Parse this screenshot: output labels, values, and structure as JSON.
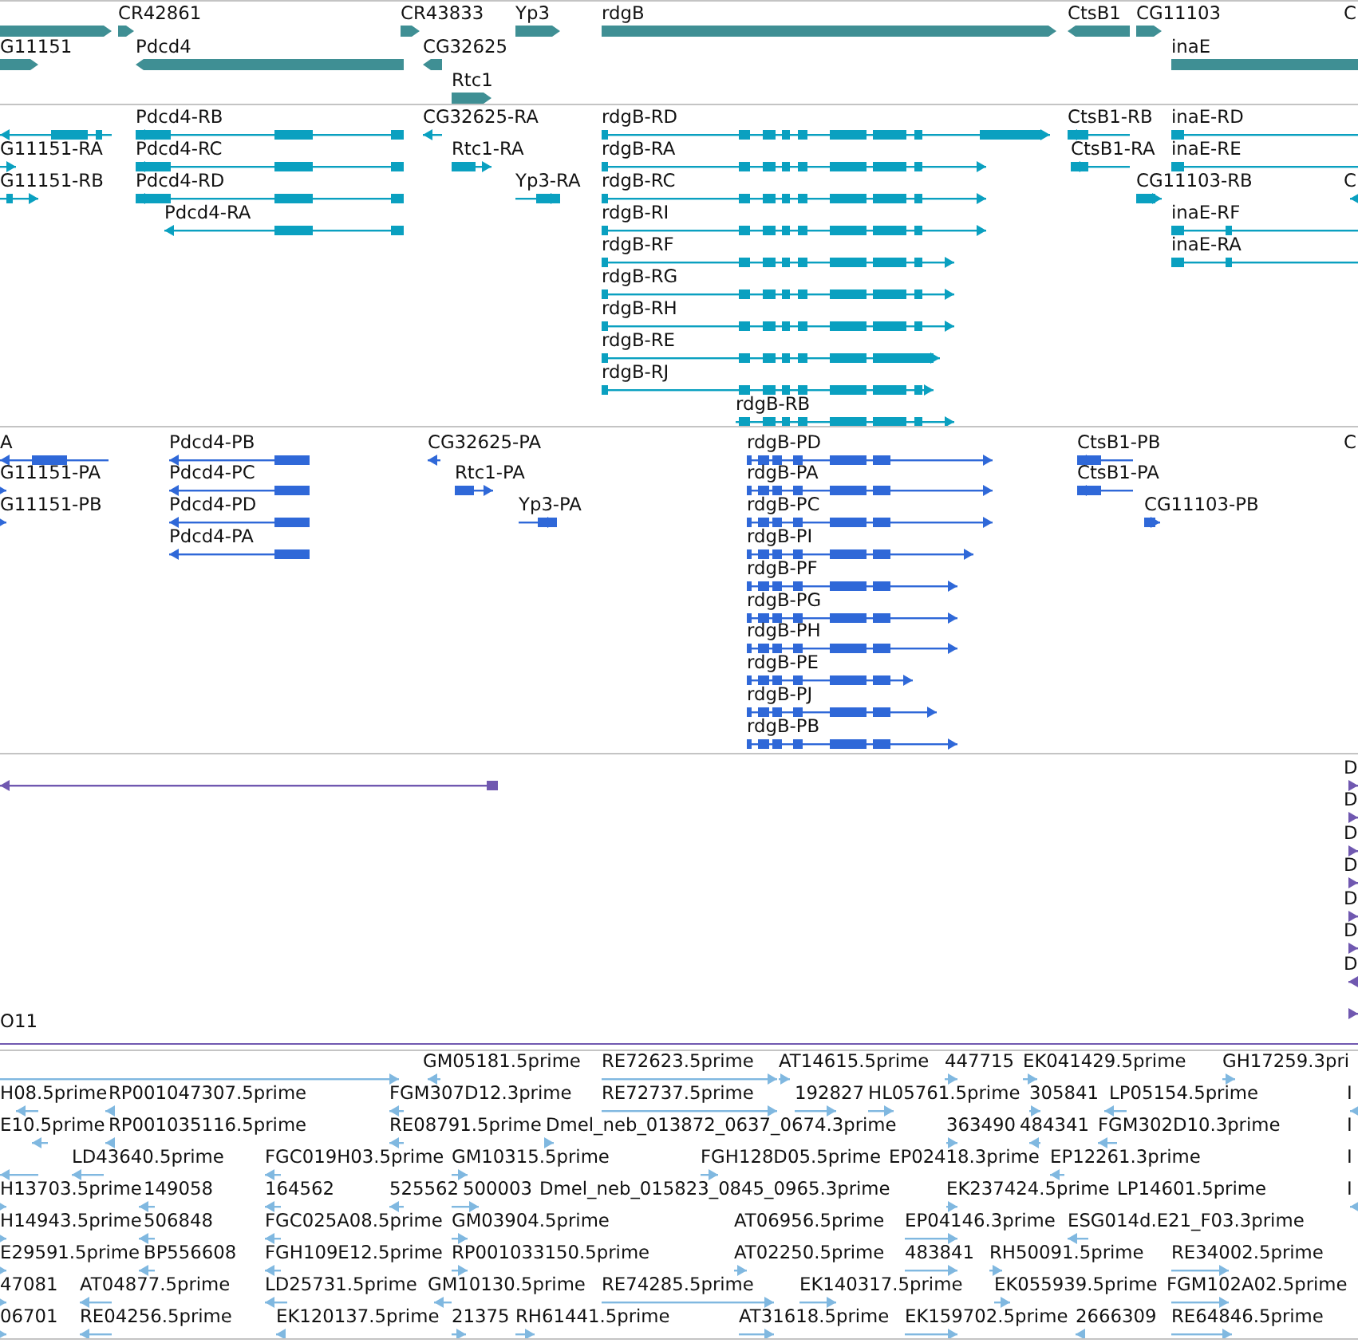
{
  "tracks": [
    {
      "kind": "gene",
      "features": [
        {
          "reverse": false
        },
        {
          "label": "G11151",
          "reverse": false
        },
        {
          "label": "CR42861",
          "reverse": false
        },
        {
          "label": "Pdcd4",
          "reverse": true
        },
        {
          "label": "CR43833",
          "reverse": false
        },
        {
          "label": "CG32625",
          "reverse": true
        },
        {
          "label": "Rtc1",
          "reverse": false
        },
        {
          "label": "Yp3",
          "reverse": false
        },
        {
          "label": "rdgB",
          "reverse": false
        },
        {
          "label": "CtsB1",
          "reverse": true
        },
        {
          "label": "CG11103",
          "reverse": false
        },
        {
          "label": "inaE",
          "reverse": false
        },
        {
          "label": "C"
        }
      ]
    },
    {
      "kind": "transcript",
      "features": [
        {
          "reverse": true
        },
        {
          "label": "G11151-RA",
          "reverse": false
        },
        {
          "label": "G11151-RB",
          "reverse": false
        },
        {
          "label": "Pdcd4-RB",
          "reverse": true
        },
        {
          "label": "Pdcd4-RC",
          "reverse": true
        },
        {
          "label": "Pdcd4-RD",
          "reverse": true
        },
        {
          "label": "Pdcd4-RA",
          "reverse": true
        },
        {
          "label": "CG32625-RA",
          "reverse": true
        },
        {
          "label": "Rtc1-RA",
          "reverse": false
        },
        {
          "label": "Yp3-RA",
          "reverse": false
        },
        {
          "label": "rdgB-RD",
          "reverse": false
        },
        {
          "label": "rdgB-RA",
          "reverse": false
        },
        {
          "label": "rdgB-RC",
          "reverse": false
        },
        {
          "label": "rdgB-RI",
          "reverse": false
        },
        {
          "label": "rdgB-RF",
          "reverse": false
        },
        {
          "label": "rdgB-RG",
          "reverse": false
        },
        {
          "label": "rdgB-RH",
          "reverse": false
        },
        {
          "label": "rdgB-RE",
          "reverse": false
        },
        {
          "label": "rdgB-RJ",
          "reverse": false
        },
        {
          "label": "rdgB-RB",
          "reverse": false
        },
        {
          "label": "CtsB1-RB",
          "reverse": true
        },
        {
          "label": "CtsB1-RA",
          "reverse": true
        },
        {
          "label": "inaE-RD",
          "reverse": false
        },
        {
          "label": "inaE-RE",
          "reverse": false
        },
        {
          "label": "CG11103-RB",
          "reverse": false
        },
        {
          "label": "inaE-RF",
          "reverse": false
        },
        {
          "label": "inaE-RA",
          "reverse": false
        },
        {
          "label": "C",
          "reverse": true
        }
      ]
    },
    {
      "kind": "protein",
      "features": [
        {
          "label": "A",
          "reverse": true
        },
        {
          "label": "G11151-PA",
          "reverse": false
        },
        {
          "label": "G11151-PB",
          "reverse": false
        },
        {
          "label": "Pdcd4-PB",
          "reverse": true
        },
        {
          "label": "Pdcd4-PC",
          "reverse": true
        },
        {
          "label": "Pdcd4-PD",
          "reverse": true
        },
        {
          "label": "Pdcd4-PA",
          "reverse": true
        },
        {
          "label": "CG32625-PA",
          "reverse": true
        },
        {
          "label": "Rtc1-PA",
          "reverse": false
        },
        {
          "label": "Yp3-PA",
          "reverse": false
        },
        {
          "label": "rdgB-PD",
          "reverse": false
        },
        {
          "label": "rdgB-PA",
          "reverse": false
        },
        {
          "label": "rdgB-PC",
          "reverse": false
        },
        {
          "label": "rdgB-PI",
          "reverse": false
        },
        {
          "label": "rdgB-PF",
          "reverse": false
        },
        {
          "label": "rdgB-PG",
          "reverse": false
        },
        {
          "label": "rdgB-PH",
          "reverse": false
        },
        {
          "label": "rdgB-PE",
          "reverse": false
        },
        {
          "label": "rdgB-PJ",
          "reverse": false
        },
        {
          "label": "rdgB-PB",
          "reverse": false
        },
        {
          "label": "CtsB1-PB",
          "reverse": true
        },
        {
          "label": "CtsB1-PA",
          "reverse": true
        },
        {
          "label": "CG11103-PB",
          "reverse": false
        },
        {
          "label": "C"
        }
      ]
    },
    {
      "kind": "alignment",
      "features": [
        {
          "reverse": true
        },
        {
          "label": "D",
          "reverse": false
        },
        {
          "label": "D",
          "reverse": false
        },
        {
          "label": "D",
          "reverse": false
        },
        {
          "label": "D",
          "reverse": false
        },
        {
          "label": "D",
          "reverse": false
        },
        {
          "label": "D",
          "reverse": false
        },
        {
          "label": "D",
          "reverse": true
        },
        {
          "reverse": false
        },
        {
          "label": "O11"
        }
      ]
    },
    {
      "kind": "est",
      "features": [
        {
          "reverse": false
        },
        {
          "label": "GM05181.5prime",
          "reverse": true
        },
        {
          "label": "RE72623.5prime",
          "reverse": false
        },
        {
          "label": "AT14615.5prime",
          "reverse": false
        },
        {
          "label": "447715",
          "reverse": false
        },
        {
          "label": "EK041429.5prime",
          "reverse": false
        },
        {
          "label": "GH17259.3pri",
          "reverse": false
        },
        {
          "label": "H08.5prime",
          "reverse": true
        },
        {
          "label": "RP001047307.5prime",
          "reverse": true
        },
        {
          "label": "FGM307D12.3prime",
          "reverse": true
        },
        {
          "label": "RE72737.5prime",
          "reverse": false
        },
        {
          "label": "192827",
          "reverse": false
        },
        {
          "label": "HL05761.5prime",
          "reverse": false
        },
        {
          "label": "305841",
          "reverse": false
        },
        {
          "label": "LP05154.5prime",
          "reverse": true
        },
        {
          "label": "I",
          "reverse": true
        },
        {
          "label": "E10.5prime",
          "reverse": true
        },
        {
          "label": "RP001035116.5prime",
          "reverse": true
        },
        {
          "label": "RE08791.5prime",
          "reverse": true
        },
        {
          "label": "Dmel_neb_013872_0637_0674.3prime",
          "reverse": false
        },
        {
          "label": "363490",
          "reverse": false
        },
        {
          "label": "484341",
          "reverse": true
        },
        {
          "label": "FGM302D10.3prime",
          "reverse": true
        },
        {
          "label": "I"
        },
        {
          "reverse": true
        },
        {
          "label": "LD43640.5prime",
          "reverse": true
        },
        {
          "label": "FGC019H03.5prime",
          "reverse": true
        },
        {
          "label": "GM10315.5prime",
          "reverse": false
        },
        {
          "label": "FGH128D05.5prime",
          "reverse": false
        },
        {
          "label": "EP02418.3prime"
        },
        {
          "label": "EP12261.3prime",
          "reverse": true
        },
        {
          "label": "I"
        },
        {
          "label": "H13703.5prime",
          "reverse": false
        },
        {
          "label": "149058",
          "reverse": true
        },
        {
          "label": "164562",
          "reverse": true
        },
        {
          "label": "525562",
          "reverse": true
        },
        {
          "label": "500003",
          "reverse": false
        },
        {
          "label": "Dmel_neb_015823_0845_0965.3prime"
        },
        {
          "label": "EK237424.5prime",
          "reverse": false
        },
        {
          "label": "LP14601.5prime"
        },
        {
          "label": "I",
          "reverse": true
        },
        {
          "label": "H14943.5prime",
          "reverse": false
        },
        {
          "label": "506848",
          "reverse": true
        },
        {
          "label": "FGC025A08.5prime",
          "reverse": true
        },
        {
          "label": "GM03904.5prime",
          "reverse": false
        },
        {
          "label": "AT06956.5prime"
        },
        {
          "label": "EP04146.3prime",
          "reverse": false
        },
        {
          "label": "ESG014d.E21_F03.3prime",
          "reverse": true
        },
        {
          "label": "E29591.5prime",
          "reverse": false
        },
        {
          "label": "BP556608",
          "reverse": true
        },
        {
          "label": "FGH109E12.5prime",
          "reverse": true
        },
        {
          "label": "RP001033150.5prime",
          "reverse": false
        },
        {
          "label": "AT02250.5prime",
          "reverse": false
        },
        {
          "label": "483841",
          "reverse": false
        },
        {
          "label": "RH50091.5prime",
          "reverse": false
        },
        {
          "label": "RE34002.5prime",
          "reverse": false
        },
        {
          "label": "47081",
          "reverse": false
        },
        {
          "label": "AT04877.5prime",
          "reverse": true
        },
        {
          "label": "LD25731.5prime",
          "reverse": true
        },
        {
          "label": "GM10130.5prime",
          "reverse": true
        },
        {
          "label": "RE74285.5prime",
          "reverse": false
        },
        {
          "label": "EK140317.5prime",
          "reverse": false
        },
        {
          "label": "EK055939.5prime",
          "reverse": false
        },
        {
          "label": "FGM102A02.5prime",
          "reverse": false
        },
        {
          "label": "06701",
          "reverse": false
        },
        {
          "label": "RE04256.5prime",
          "reverse": true
        },
        {
          "label": "EK120137.5prime",
          "reverse": true
        },
        {
          "label": "21375",
          "reverse": false
        },
        {
          "label": "RH61441.5prime",
          "reverse": false
        },
        {
          "label": "AT31618.5prime",
          "reverse": false
        },
        {
          "label": "EK159702.5prime",
          "reverse": false
        },
        {
          "label": "2666309",
          "reverse": true
        },
        {
          "label": "RE64846.5prime",
          "reverse": false
        }
      ]
    }
  ]
}
